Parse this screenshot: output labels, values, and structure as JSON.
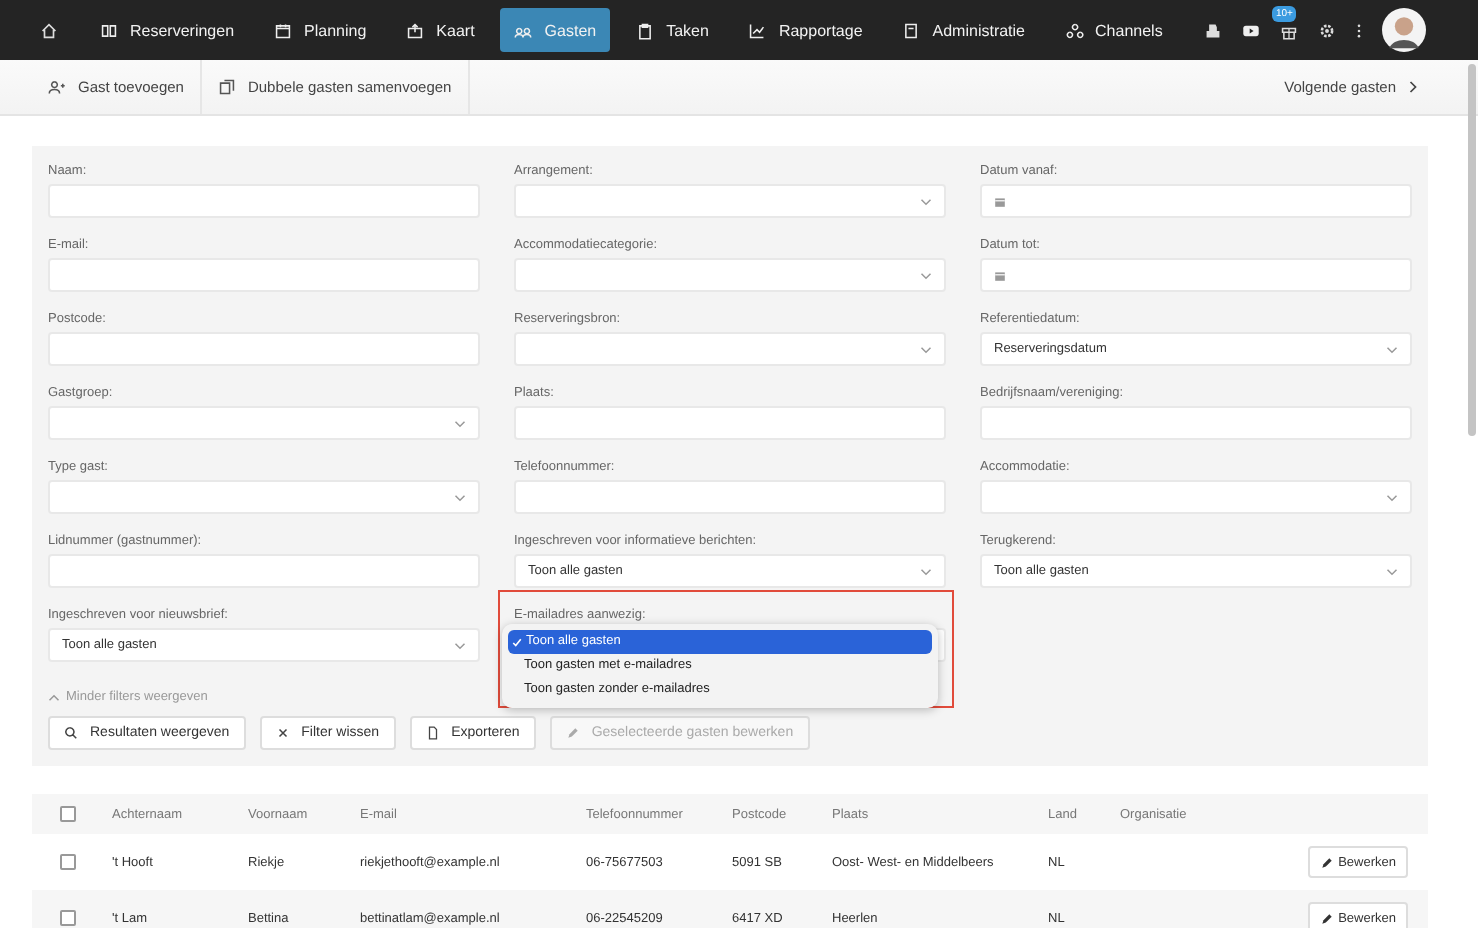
{
  "nav": {
    "items": [
      {
        "label": "Reserveringen",
        "selected": false
      },
      {
        "label": "Planning",
        "selected": false
      },
      {
        "label": "Kaart",
        "selected": false
      },
      {
        "label": "Gasten",
        "selected": true
      },
      {
        "label": "Taken",
        "selected": false
      },
      {
        "label": "Rapportage",
        "selected": false
      },
      {
        "label": "Administratie",
        "selected": false
      },
      {
        "label": "Channels",
        "selected": false
      }
    ],
    "badge": "10+"
  },
  "toolbar": {
    "actions": [
      {
        "label": "Gast toevoegen"
      },
      {
        "label": "Dubbele gasten samenvoegen"
      }
    ],
    "next": "Volgende gasten"
  },
  "filters": [
    {
      "label": "Naam:",
      "kind": "text"
    },
    {
      "label": "Arrangement:",
      "kind": "select"
    },
    {
      "label": "Datum vanaf:",
      "kind": "date"
    },
    {
      "label": "E-mail:",
      "kind": "text"
    },
    {
      "label": "Accommodatiecategorie:",
      "kind": "select"
    },
    {
      "label": "Datum tot:",
      "kind": "date"
    },
    {
      "label": "Postcode:",
      "kind": "text"
    },
    {
      "label": "Reserveringsbron:",
      "kind": "select"
    },
    {
      "label": "Referentiedatum:",
      "kind": "select",
      "value": "Reserveringsdatum"
    },
    {
      "label": "Gastgroep:",
      "kind": "select"
    },
    {
      "label": "Plaats:",
      "kind": "text"
    },
    {
      "label": "Bedrijfsnaam/vereniging:",
      "kind": "text"
    },
    {
      "label": "Type gast:",
      "kind": "select"
    },
    {
      "label": "Telefoonnummer:",
      "kind": "text"
    },
    {
      "label": "Accommodatie:",
      "kind": "select"
    },
    {
      "label": "Lidnummer (gastnummer):",
      "kind": "text"
    },
    {
      "label": "Ingeschreven voor informatieve berichten:",
      "kind": "select",
      "value": "Toon alle gasten"
    },
    {
      "label": "Terugkerend:",
      "kind": "select",
      "value": "Toon alle gasten"
    },
    {
      "label": "Ingeschreven voor nieuwsbrief:",
      "kind": "select",
      "value": "Toon alle gasten"
    },
    {
      "label": "E-mailadres aanwezig:",
      "kind": "select",
      "highlighted": true,
      "options": [
        {
          "label": "Toon alle gasten",
          "selected": true
        },
        {
          "label": "Toon gasten met e-mailadres",
          "selected": false
        },
        {
          "label": "Toon gasten zonder e-mailadres",
          "selected": false
        }
      ]
    }
  ],
  "less_filters": "Minder filters weergeven",
  "buttons": [
    {
      "label": "Resultaten weergeven",
      "disabled": false
    },
    {
      "label": "Filter wissen",
      "disabled": false
    },
    {
      "label": "Exporteren",
      "disabled": false
    },
    {
      "label": "Geselecteerde gasten bewerken",
      "disabled": true
    }
  ],
  "table": {
    "all_checked": false,
    "columns": [
      "Achternaam",
      "Voornaam",
      "E-mail",
      "Telefoonnummer",
      "Postcode",
      "Plaats",
      "Land",
      "Organisatie"
    ],
    "rows": [
      {
        "checked": false,
        "cells": [
          "'t Hooft",
          "Riekje",
          "riekjethooft@example.nl",
          "06-75677503",
          "5091 SB",
          "Oost- West- en Middelbeers",
          "NL",
          ""
        ],
        "action": "Bewerken"
      },
      {
        "checked": false,
        "cells": [
          "'t Lam",
          "Bettina",
          "bettinatlam@example.nl",
          "06-22545209",
          "6417 XD",
          "Heerlen",
          "NL",
          ""
        ],
        "action": "Bewerken"
      }
    ]
  }
}
